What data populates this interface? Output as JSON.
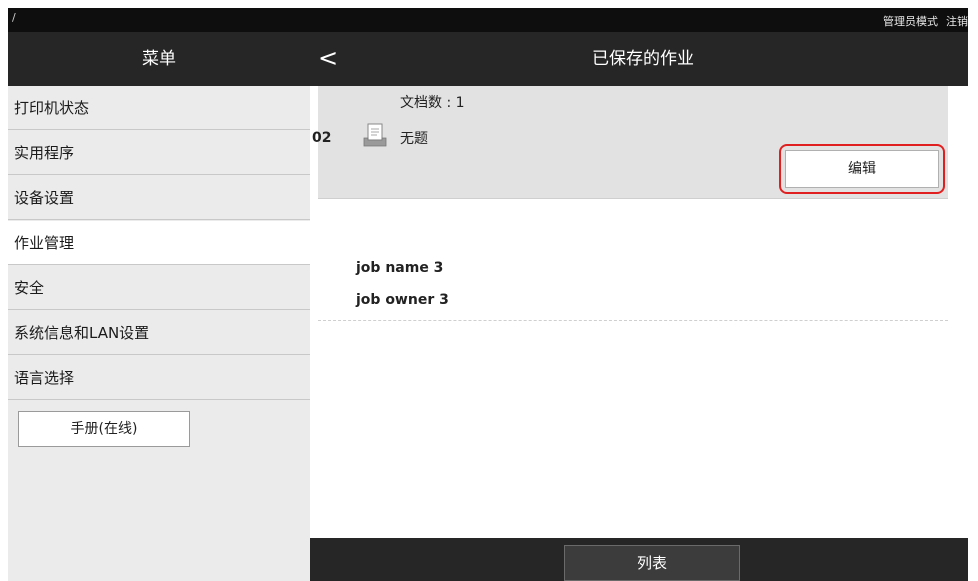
{
  "status_bar": {
    "path": "/",
    "admin_mode": "管理员模式",
    "logout": "注销"
  },
  "header": {
    "menu_title": "菜单",
    "back": "<",
    "page_title": "已保存的作业"
  },
  "sidebar": {
    "items": [
      {
        "label": "打印机状态",
        "active": false
      },
      {
        "label": "实用程序",
        "active": false
      },
      {
        "label": "设备设置",
        "active": false
      },
      {
        "label": "作业管理",
        "active": true
      },
      {
        "label": "安全",
        "active": false
      },
      {
        "label": "系统信息和LAN设置",
        "active": false
      },
      {
        "label": "语言选择",
        "active": false
      }
    ],
    "manual_button": "手册(在线)"
  },
  "job": {
    "doc_count": "文档数 : 1",
    "number": "02",
    "title": "无题",
    "edit_button": "编辑",
    "name": "job name 3",
    "owner": "job owner 3"
  },
  "footer": {
    "list_button": "列表"
  },
  "colors": {
    "bar_dark": "#262626",
    "highlight": "#e02020",
    "sidebar_bg": "#ebebeb",
    "card_bg": "#e2e2e2"
  }
}
